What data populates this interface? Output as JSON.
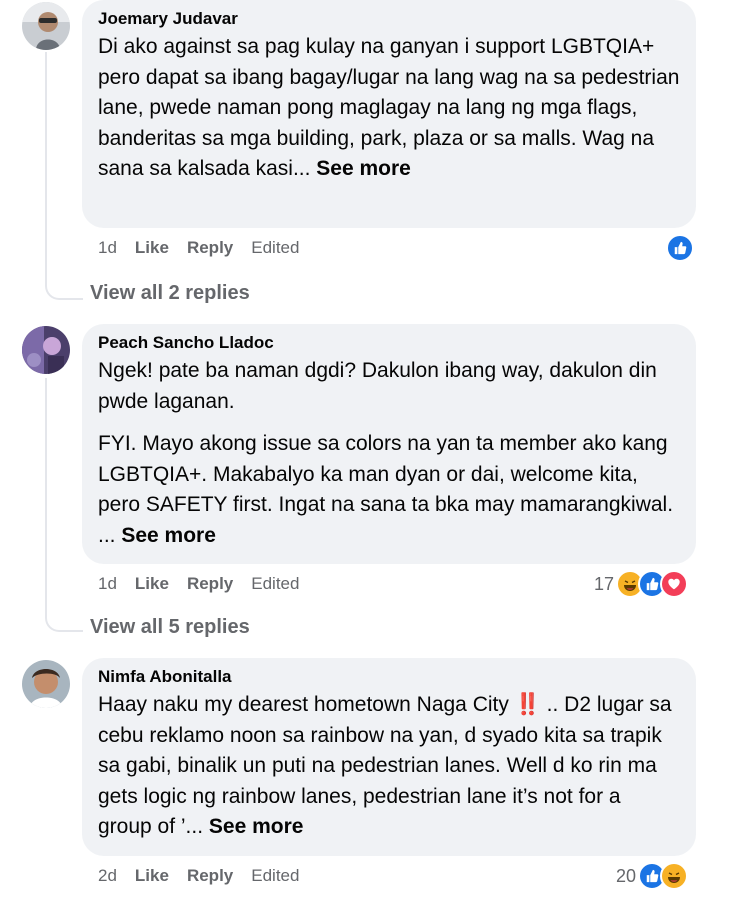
{
  "comments": [
    {
      "author": "Joemary Judavar",
      "paragraphs": [
        "Di ako against sa pag kulay na ganyan i support LGBTQIA+ pero dapat sa ibang bagay/lugar na lang wag na sa pedestrian lane, pwede naman pong maglagay na lang ng mga flags, banderitas sa mga building, park, plaza or sa malls. Wag na sana sa kalsada kasi..."
      ],
      "see_more": "See more",
      "time": "1d",
      "like_label": "Like",
      "reply_label": "Reply",
      "edited_label": "Edited",
      "reaction_count": "",
      "reactions": [
        "like-icon"
      ],
      "view_replies": "View all 2 replies"
    },
    {
      "author": "Peach Sancho Lladoc",
      "paragraphs": [
        "Ngek! pate ba naman dgdi? Dakulon ibang way, dakulon din pwde laganan.",
        "FYI. Mayo akong issue sa colors na yan ta member ako kang LGBTQIA+. Makabalyo ka man dyan or dai, welcome kita, pero SAFETY first. Ingat na sana ta bka may mamarangkiwal. ..."
      ],
      "see_more": "See more",
      "time": "1d",
      "like_label": "Like",
      "reply_label": "Reply",
      "edited_label": "Edited",
      "reaction_count": "17",
      "reactions": [
        "haha-icon",
        "like-icon",
        "love-icon"
      ],
      "view_replies": "View all 5 replies"
    },
    {
      "author": "Nimfa Abonitalla",
      "paragraphs": [
        "Haay naku my dearest hometown Naga City ‼️ .. D2 lugar sa cebu reklamo noon sa rainbow na yan, d syado kita sa trapik sa gabi, binalik un puti na pedestrian lanes. Well d ko rin ma gets logic ng rainbow lanes, pedestrian lane it’s not for a group of ’..."
      ],
      "see_more": "See more",
      "time": "2d",
      "like_label": "Like",
      "reply_label": "Reply",
      "edited_label": "Edited",
      "reaction_count": "20",
      "reactions": [
        "like-icon",
        "haha-icon"
      ],
      "view_replies": ""
    }
  ],
  "colors": {
    "bubble": "#f0f2f5",
    "secondary_text": "#65676b",
    "like_blue": "#1b74e4",
    "haha_yellow": "#f7b125",
    "love_red": "#f33e58"
  }
}
